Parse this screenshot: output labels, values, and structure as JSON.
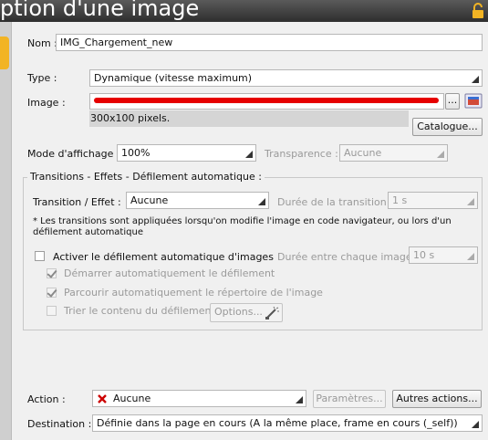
{
  "window": {
    "title": "ption d'une image"
  },
  "form": {
    "nom_label": "Nom :",
    "nom_value": "IMG_Chargement_new",
    "type_label": "Type :",
    "type_value": "Dynamique (vitesse maximum)",
    "image_label": "Image :",
    "image_button": "...",
    "image_info": "300x100 pixels.",
    "catalogue_button": "Catalogue...",
    "mode_label": "Mode d'affichage :",
    "mode_value": "100%",
    "transparence_label": "Transparence :",
    "transparence_value": "Aucune"
  },
  "transitions": {
    "group_title": "Transitions - Effets - Défilement automatique :",
    "effet_label": "Transition / Effet :",
    "effet_value": "Aucune",
    "duree_label": "Durée de la transition :",
    "duree_value": "1 s",
    "note": "* Les transitions sont appliquées lorsqu'on modifie l'image en code navigateur, ou lors d'un défilement automatique",
    "activer_label": "Activer le défilement automatique d'images",
    "duree_image_label": "Durée entre chaque image :",
    "duree_image_value": "10 s",
    "demarrer_label": "Démarrer automatiquement le défilement",
    "parcourir_label": "Parcourir automatiquement le répertoire de l'image",
    "trier_label": "Trier le contenu du défilement",
    "options_button": "Options..."
  },
  "action": {
    "action_label": "Action :",
    "action_value": "Aucune",
    "parametres_button": "Paramètres...",
    "autres_button": "Autres actions...",
    "destination_label": "Destination :",
    "destination_value": "Définie dans la page en cours (A la même place, frame en cours (_self))"
  },
  "colors": {
    "accent": "#f2b424",
    "redaction": "#e60000",
    "no-action": "#cc0000"
  }
}
